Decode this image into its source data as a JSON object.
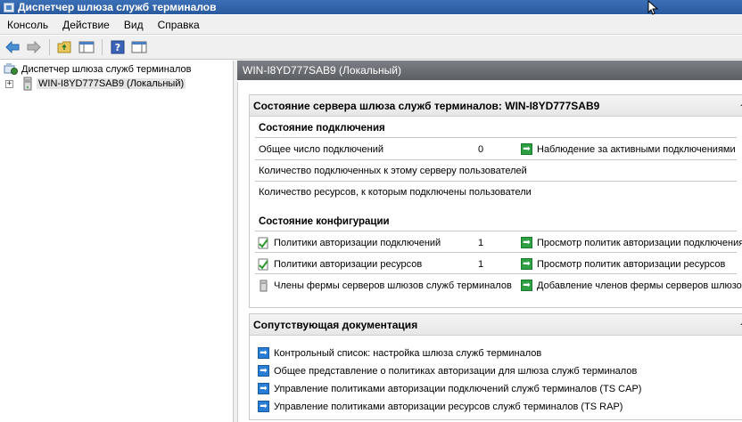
{
  "window": {
    "title": "Диспетчер шлюза служб терминалов"
  },
  "menu": {
    "items": [
      "Консоль",
      "Действие",
      "Вид",
      "Справка"
    ]
  },
  "toolbar": {
    "buttons": [
      "back-icon",
      "forward-icon",
      "up-folder-icon",
      "console-tree-icon",
      "help-icon",
      "action-pane-icon"
    ]
  },
  "tree": {
    "root_label": "Диспетчер шлюза служб терминалов",
    "child_label": "WIN-I8YD777SAB9 (Локальный)",
    "expander": "+"
  },
  "pane": {
    "header": "WIN-I8YD777SAB9 (Локальный)"
  },
  "status_section": {
    "title": "Состояние сервера шлюза служб терминалов: WIN-I8YD777SAB9",
    "connection": {
      "heading": "Состояние подключения",
      "rows": [
        {
          "label": "Общее число подключений",
          "value": "0",
          "link": "Наблюдение за активными подключениями"
        },
        {
          "label": "Количество подключенных к этому серверу пользователей",
          "value": "",
          "link": ""
        },
        {
          "label": "Количество ресурсов, к которым подключены пользователи",
          "value": "",
          "link": ""
        }
      ]
    },
    "config": {
      "heading": "Состояние конфигурации",
      "rows": [
        {
          "label": "Политики авторизации подключений",
          "value": "1",
          "link": "Просмотр политик авторизации подключения"
        },
        {
          "label": "Политики авторизации ресурсов",
          "value": "1",
          "link": "Просмотр политик авторизации ресурсов"
        },
        {
          "label": "Члены фермы серверов шлюзов служб терминалов",
          "value": "",
          "link": "Добавление членов фермы серверов шлюзов"
        }
      ]
    }
  },
  "docs_section": {
    "title": "Сопутствующая документация",
    "links": [
      "Контрольный список: настройка шлюза служб терминалов",
      "Общее представление о политиках авторизации для шлюза служб терминалов",
      "Управление политиками авторизации подключений служб терминалов (TS CAP)",
      "Управление политиками авторизации ресурсов служб терминалов (TS RAP)"
    ]
  },
  "colors": {
    "title_bar": "#2a5a9e",
    "pane_header": "#5b5e63",
    "link_green": "#2ea043",
    "link_blue": "#2a7dd4"
  }
}
